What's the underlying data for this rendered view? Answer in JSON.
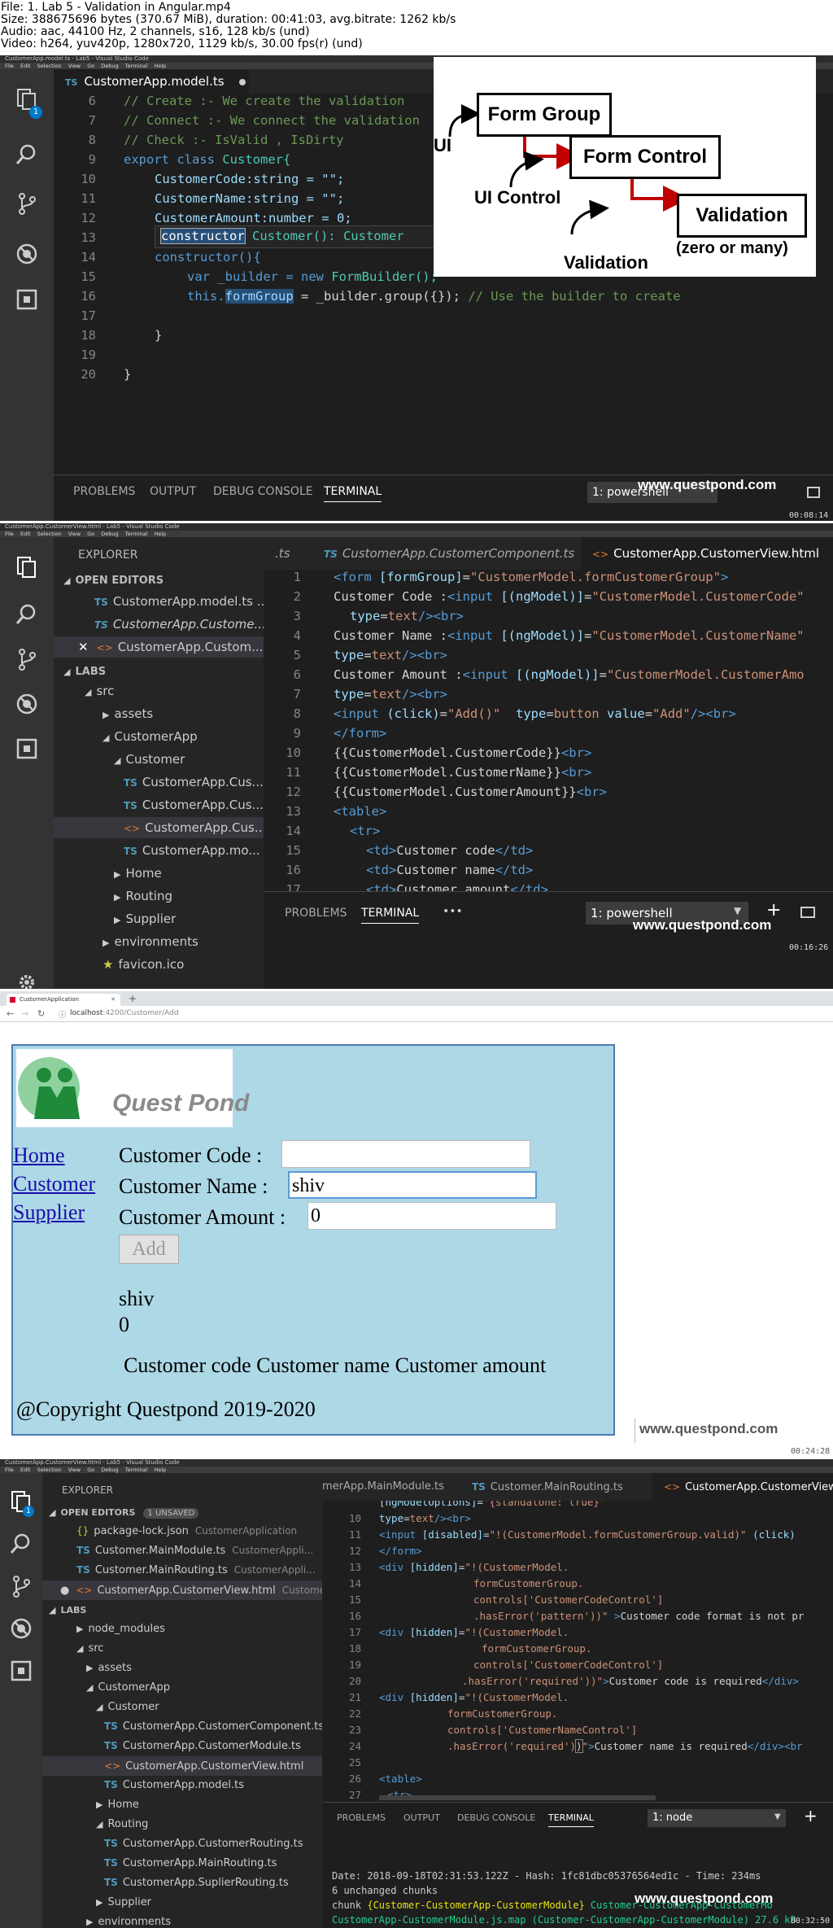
{
  "info": {
    "file": "File: 1. Lab 5 - Validation in Angular.mp4",
    "size": "Size: 388675696 bytes (370.67 MiB), duration: 00:41:03, avg.bitrate: 1262 kb/s",
    "audio": "Audio: aac, 44100 Hz, 2 channels, s16, 128 kb/s (und)",
    "video": "Video: h264, yuv420p, 1280x720, 1129 kb/s, 30.00 fps(r) (und)"
  },
  "watermark": "www.questpond.com",
  "panel1": {
    "window_title": "CustomerApp.model.ts - Lab5 - Visual Studio Code",
    "menu": [
      "File",
      "Edit",
      "Selection",
      "View",
      "Go",
      "Debug",
      "Terminal",
      "Help"
    ],
    "badge": "1",
    "tab": "CustomerApp.model.ts",
    "lines": [
      "6",
      "7",
      "8",
      "9",
      "10",
      "11",
      "12",
      "13",
      "14",
      "15",
      "16",
      "17",
      "18",
      "19",
      "20"
    ],
    "code": {
      "l6": "// Create :- We create the validation",
      "l7": "// Connect :- We connect the validation",
      "l8": "// Check :- IsValid , IsDirty",
      "l9a": "export class ",
      "l9b": "Customer{",
      "l10": "CustomerCode:string = \"\";",
      "l11": "CustomerName:string = \"\";",
      "l12": "CustomerAmount:number = 0;",
      "l13a": "constructor",
      "l13b": " Customer(): Customer",
      "l14": "constructor(){",
      "l15a": "var _builder = ",
      "l15b": "new ",
      "l15c": "FormBuilder();",
      "l16a": "this.",
      "l16b": "formGroup",
      "l16c": " = _builder.group({}); ",
      "l16d": "// Use the builder to create",
      "l18": "}",
      "l20": "}"
    },
    "bottom_tabs": [
      "PROBLEMS",
      "OUTPUT",
      "DEBUG CONSOLE",
      "TERMINAL"
    ],
    "terminal_select": "1: powershell",
    "timestamp": "00:08:14",
    "diagram": {
      "form_group": "Form Group",
      "form_control": "Form Control",
      "validation_box": "Validation",
      "ui": "UI",
      "ui_control": "UI Control",
      "validation_label": "Validation",
      "zero_many": "(zero or many)",
      "arrow_color": "#c00000"
    }
  },
  "panel2": {
    "window_title": "CustomerApp.CustomerView.html - Lab5 - Visual Studio Code",
    "menu": [
      "File",
      "Edit",
      "Selection",
      "View",
      "Go",
      "Debug",
      "Terminal",
      "Help"
    ],
    "explorer": "EXPLORER",
    "open_editors": "OPEN EDITORS",
    "open_files": [
      "CustomerApp.model.ts ...",
      "CustomerApp.Custome...",
      "CustomerApp.Custom..."
    ],
    "labs": "LABS",
    "tree": [
      "src",
      "assets",
      "CustomerApp",
      "Customer",
      "CustomerApp.Cus...",
      "CustomerApp.Cus...",
      "CustomerApp.Cus...",
      "CustomerApp.mo...",
      "Home",
      "Routing",
      "Supplier",
      "environments",
      "favicon.ico"
    ],
    "tabs": [
      ".ts",
      "CustomerApp.CustomerComponent.ts",
      "CustomerApp.CustomerView.html"
    ],
    "lines": [
      "1",
      "2",
      "3",
      "4",
      "5",
      "6",
      "7",
      "8",
      "9",
      "10",
      "11",
      "12",
      "13",
      "14",
      "15",
      "16",
      "17"
    ],
    "timestamp": "00:16:26",
    "terminal_select": "1: powershell",
    "bottom_tabs": [
      "PROBLEMS",
      "TERMINAL",
      "•••"
    ]
  },
  "panel3": {
    "tab_title": "CustomerApplication",
    "url_host": "localhost",
    "url_rest": ":4200/Customer/Add",
    "logo_text": "Quest Pond",
    "nav": [
      "Home",
      "Customer",
      "Supplier"
    ],
    "labels": {
      "code": "Customer Code :",
      "name": "Customer Name :",
      "amount": "Customer Amount :"
    },
    "values": {
      "code": "",
      "name": "shiv",
      "amount": "0"
    },
    "add_button": "Add",
    "output_name": "shiv",
    "output_amount": "0",
    "table_header": "Customer code Customer name Customer amount",
    "copyright": "@Copyright Questpond 2019-2020",
    "timestamp": "00:24:28"
  },
  "panel4": {
    "window_title": "CustomerApp.CustomerView.html - Lab5 - Visual Studio Code",
    "menu": [
      "File",
      "Edit",
      "Selection",
      "View",
      "Go",
      "Debug",
      "Terminal",
      "Help"
    ],
    "badge": "1",
    "explorer": "EXPLORER",
    "open_editors": "OPEN EDITORS",
    "unsaved": "1 UNSAVED",
    "open_files": [
      {
        "name": "package-lock.json",
        "dir": "CustomerApplication"
      },
      {
        "name": "Customer.MainModule.ts",
        "dir": "CustomerAppli..."
      },
      {
        "name": "Customer.MainRouting.ts",
        "dir": "CustomerAppli..."
      },
      {
        "name": "CustomerApp.CustomerView.html",
        "dir": "Customer..."
      }
    ],
    "labs": "LABS",
    "tree": [
      "node_modules",
      "src",
      "assets",
      "CustomerApp",
      "Customer",
      "CustomerApp.CustomerComponent.ts",
      "CustomerApp.CustomerModule.ts",
      "CustomerApp.CustomerView.html",
      "CustomerApp.model.ts",
      "Home",
      "Routing",
      "CustomerApp.CustomerRouting.ts",
      "CustomerApp.MainRouting.ts",
      "CustomerApp.SuplierRouting.ts",
      "Supplier",
      "environments"
    ],
    "tabs": [
      "merApp.MainModule.ts",
      "Customer.MainRouting.ts",
      "CustomerApp.CustomerView."
    ],
    "lines": [
      "10",
      "11",
      "12",
      "13",
      "14",
      "15",
      "16",
      "17",
      "18",
      "19",
      "20",
      "21",
      "22",
      "23",
      "24",
      "25",
      "26",
      "27"
    ],
    "bottom_tabs": [
      "PROBLEMS",
      "OUTPUT",
      "DEBUG CONSOLE",
      "TERMINAL"
    ],
    "terminal_select": "1: node",
    "term_line1": "Date: 2018-09-18T02:31:53.122Z - Hash: 1fc81dbc05376564ed1c - Time: 234ms",
    "term_line2": "6 unchanged chunks",
    "term_line3a": "chunk ",
    "term_line3b": "{Customer-CustomerApp-CustomerModule}",
    "term_line3c": " Customer-CustomerApp-CustomerMo",
    "term_line4": "CustomerApp-CustomerModule.js.map (Customer-CustomerApp-CustomerModule) 27.6 kB",
    "timestamp": "00:32:50"
  }
}
